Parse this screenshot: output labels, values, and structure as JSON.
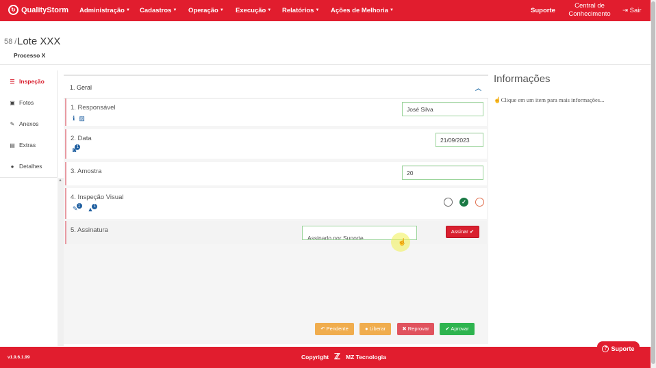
{
  "app": {
    "logo_text": "QualityStorm",
    "nav": [
      {
        "label": "Administração"
      },
      {
        "label": "Cadastros"
      },
      {
        "label": "Operação"
      },
      {
        "label": "Execução"
      },
      {
        "label": "Relatórios"
      },
      {
        "label": "Ações de Melhoria"
      }
    ],
    "support": "Suporte",
    "central_line1": "Central de",
    "central_line2": "Conhecimento",
    "logout": "Sair"
  },
  "header": {
    "batch_number": "58 /",
    "batch_title": "Lote XXX",
    "process": "Processo X"
  },
  "sidebar": {
    "items": [
      {
        "label": "Inspeção",
        "icon": "list-icon",
        "active": true
      },
      {
        "label": "Fotos",
        "icon": "camera-icon"
      },
      {
        "label": "Anexos",
        "icon": "paperclip-icon"
      },
      {
        "label": "Extras",
        "icon": "document-icon"
      },
      {
        "label": "Detalhes",
        "icon": "info-icon"
      }
    ]
  },
  "inspection": {
    "group_title": "1. Geral",
    "items": [
      {
        "label": "1. Responsável",
        "value": "José Silva"
      },
      {
        "label": "2. Data",
        "value": "21/09/2023",
        "badge": "1"
      },
      {
        "label": "3. Amostra",
        "value": "20"
      },
      {
        "label": "4. Inspeção Visual",
        "badge1": "1",
        "badge2": "1"
      },
      {
        "label": "5. Assinatura",
        "signature": "Assinado por Suporte",
        "sign_button": "Assinar"
      }
    ]
  },
  "actions": {
    "pending": "Pendente",
    "release": "Liberar",
    "reject": "Reprovar",
    "approve": "Aprovar"
  },
  "info_panel": {
    "title": "Informações",
    "hint": "Clique em um item para mais informações..."
  },
  "footer": {
    "version": "v1.9.6.1.99",
    "copyright": "Copyright",
    "company": "MZ Tecnologia",
    "support_button": "Suporte"
  },
  "colors": {
    "brand": "#e11d2e",
    "ok": "#1a7a45",
    "pending": "#f0ad4e",
    "reject": "#e0535e",
    "approve": "#2eb44f"
  }
}
